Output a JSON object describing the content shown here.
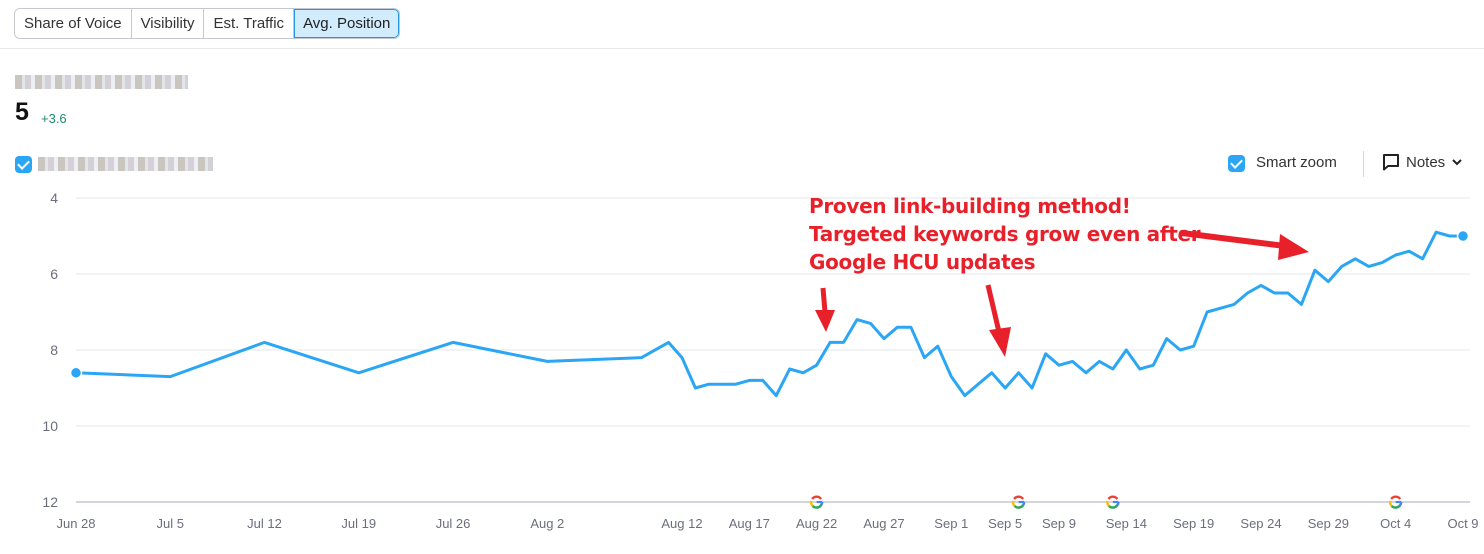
{
  "tabs": [
    {
      "label": "Share of Voice",
      "active": false
    },
    {
      "label": "Visibility",
      "active": false
    },
    {
      "label": "Est. Traffic",
      "active": false
    },
    {
      "label": "Avg. Position",
      "active": true
    }
  ],
  "summary": {
    "value": "5",
    "delta": "+3.6"
  },
  "controls": {
    "smart_zoom_label": "Smart zoom",
    "smart_zoom_checked": true,
    "notes_label": "Notes"
  },
  "annotation": {
    "lines": [
      "Proven link-building method!",
      "Targeted keywords grow even after",
      "Google HCU updates"
    ],
    "color": "#e8202a"
  },
  "colors": {
    "line": "#2ba6f5",
    "grid": "#e6e7eb",
    "axis_text": "#6b6f7a"
  },
  "chart_data": {
    "type": "line",
    "title": "",
    "xlabel": "",
    "ylabel": "Avg. Position",
    "y_inverted": true,
    "ylim": [
      12,
      4
    ],
    "yticks": [
      4,
      6,
      8,
      10,
      12
    ],
    "grid": true,
    "xrange_days": [
      0,
      103
    ],
    "xticks": [
      {
        "label": "Jun 28",
        "day": 0
      },
      {
        "label": "Jul 5",
        "day": 7
      },
      {
        "label": "Jul 12",
        "day": 14
      },
      {
        "label": "Jul 19",
        "day": 21
      },
      {
        "label": "Jul 26",
        "day": 28
      },
      {
        "label": "Aug 2",
        "day": 35
      },
      {
        "label": "Aug 12",
        "day": 45
      },
      {
        "label": "Aug 17",
        "day": 50
      },
      {
        "label": "Aug 22",
        "day": 55
      },
      {
        "label": "Aug 27",
        "day": 60
      },
      {
        "label": "Sep 1",
        "day": 65
      },
      {
        "label": "Sep 5",
        "day": 69
      },
      {
        "label": "Sep 9",
        "day": 73
      },
      {
        "label": "Sep 14",
        "day": 78
      },
      {
        "label": "Sep 19",
        "day": 83
      },
      {
        "label": "Sep 24",
        "day": 88
      },
      {
        "label": "Sep 29",
        "day": 93
      },
      {
        "label": "Oct 4",
        "day": 98
      },
      {
        "label": "Oct 9",
        "day": 103
      }
    ],
    "google_updates_days": [
      55,
      70,
      77,
      98
    ],
    "series": [
      {
        "name": "tracked domain",
        "points": [
          {
            "day": 0,
            "value": 8.6
          },
          {
            "day": 7,
            "value": 8.7
          },
          {
            "day": 14,
            "value": 7.8
          },
          {
            "day": 21,
            "value": 8.6
          },
          {
            "day": 28,
            "value": 7.8
          },
          {
            "day": 35,
            "value": 8.3
          },
          {
            "day": 42,
            "value": 8.2
          },
          {
            "day": 44,
            "value": 7.8
          },
          {
            "day": 45,
            "value": 8.2
          },
          {
            "day": 46,
            "value": 9.0
          },
          {
            "day": 47,
            "value": 8.9
          },
          {
            "day": 48,
            "value": 8.9
          },
          {
            "day": 49,
            "value": 8.9
          },
          {
            "day": 50,
            "value": 8.8
          },
          {
            "day": 51,
            "value": 8.8
          },
          {
            "day": 52,
            "value": 9.2
          },
          {
            "day": 53,
            "value": 8.5
          },
          {
            "day": 54,
            "value": 8.6
          },
          {
            "day": 55,
            "value": 8.4
          },
          {
            "day": 56,
            "value": 7.8
          },
          {
            "day": 57,
            "value": 7.8
          },
          {
            "day": 58,
            "value": 7.2
          },
          {
            "day": 59,
            "value": 7.3
          },
          {
            "day": 60,
            "value": 7.7
          },
          {
            "day": 61,
            "value": 7.4
          },
          {
            "day": 62,
            "value": 7.4
          },
          {
            "day": 63,
            "value": 8.2
          },
          {
            "day": 64,
            "value": 7.9
          },
          {
            "day": 65,
            "value": 8.7
          },
          {
            "day": 66,
            "value": 9.2
          },
          {
            "day": 67,
            "value": 8.9
          },
          {
            "day": 68,
            "value": 8.6
          },
          {
            "day": 69,
            "value": 9.0
          },
          {
            "day": 70,
            "value": 8.6
          },
          {
            "day": 71,
            "value": 9.0
          },
          {
            "day": 72,
            "value": 8.1
          },
          {
            "day": 73,
            "value": 8.4
          },
          {
            "day": 74,
            "value": 8.3
          },
          {
            "day": 75,
            "value": 8.6
          },
          {
            "day": 76,
            "value": 8.3
          },
          {
            "day": 77,
            "value": 8.5
          },
          {
            "day": 78,
            "value": 8.0
          },
          {
            "day": 79,
            "value": 8.5
          },
          {
            "day": 80,
            "value": 8.4
          },
          {
            "day": 81,
            "value": 7.7
          },
          {
            "day": 82,
            "value": 8.0
          },
          {
            "day": 83,
            "value": 7.9
          },
          {
            "day": 84,
            "value": 7.0
          },
          {
            "day": 85,
            "value": 6.9
          },
          {
            "day": 86,
            "value": 6.8
          },
          {
            "day": 87,
            "value": 6.5
          },
          {
            "day": 88,
            "value": 6.3
          },
          {
            "day": 89,
            "value": 6.5
          },
          {
            "day": 90,
            "value": 6.5
          },
          {
            "day": 91,
            "value": 6.8
          },
          {
            "day": 92,
            "value": 5.9
          },
          {
            "day": 93,
            "value": 6.2
          },
          {
            "day": 94,
            "value": 5.8
          },
          {
            "day": 95,
            "value": 5.6
          },
          {
            "day": 96,
            "value": 5.8
          },
          {
            "day": 97,
            "value": 5.7
          },
          {
            "day": 98,
            "value": 5.5
          },
          {
            "day": 99,
            "value": 5.4
          },
          {
            "day": 100,
            "value": 5.6
          },
          {
            "day": 101,
            "value": 4.9
          },
          {
            "day": 102,
            "value": 5.0
          },
          {
            "day": 103,
            "value": 5.0
          }
        ]
      }
    ]
  }
}
